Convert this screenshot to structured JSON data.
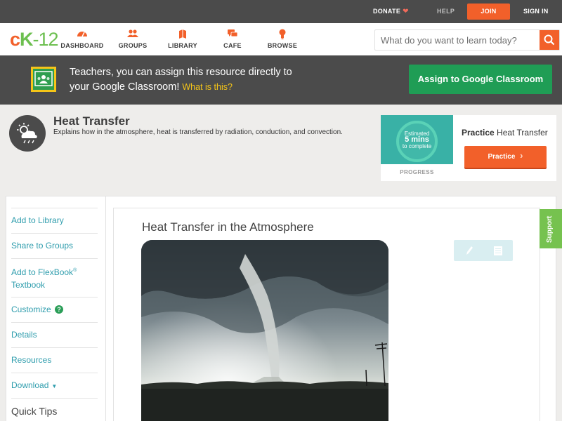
{
  "topbar": {
    "donate": "DONATE",
    "help": "HELP",
    "join": "JOIN",
    "signin": "SIGN IN"
  },
  "nav": {
    "logo": {
      "c": "c",
      "k": "K",
      "rest": "-12"
    },
    "items": [
      {
        "label": "DASHBOARD",
        "icon": "dashboard-icon"
      },
      {
        "label": "GROUPS",
        "icon": "groups-icon"
      },
      {
        "label": "LIBRARY",
        "icon": "library-icon"
      },
      {
        "label": "CAFE",
        "icon": "cafe-icon"
      },
      {
        "label": "BROWSE",
        "icon": "browse-icon"
      }
    ],
    "search_placeholder": "What do you want to learn today?"
  },
  "banner": {
    "line1": "Teachers, you can assign this resource directly to",
    "line2": "your Google Classroom!",
    "what_is_this": "What is this?",
    "assign_button": "Assign to Google Classroom"
  },
  "header": {
    "title": "Heat Transfer",
    "description": "Explains how in the atmosphere, heat is transferred by radiation, conduction, and convection.",
    "icon": "weather-icon"
  },
  "practice": {
    "estimated": "Estimated",
    "mins": "5 mins",
    "to_complete": "to complete",
    "progress_label": "PROGRESS",
    "title_bold": "Practice",
    "title_rest": "Heat Transfer",
    "button": "Practice"
  },
  "sidebar": {
    "add_to_library": "Add to Library",
    "share_to_groups": "Share to Groups",
    "add_to_flexbook": "Add to FlexBook",
    "reg_mark": "®",
    "textbook": "Textbook",
    "customize": "Customize",
    "details": "Details",
    "resources": "Resources",
    "download": "Download",
    "quick_tips": "Quick Tips"
  },
  "article": {
    "title": "Heat Transfer in the Atmosphere"
  },
  "support": "Support",
  "colors": {
    "accent": "#f2602a",
    "green": "#1f9d55",
    "teal_link": "#2f9dad",
    "dark_bar": "#4b4b4b"
  }
}
